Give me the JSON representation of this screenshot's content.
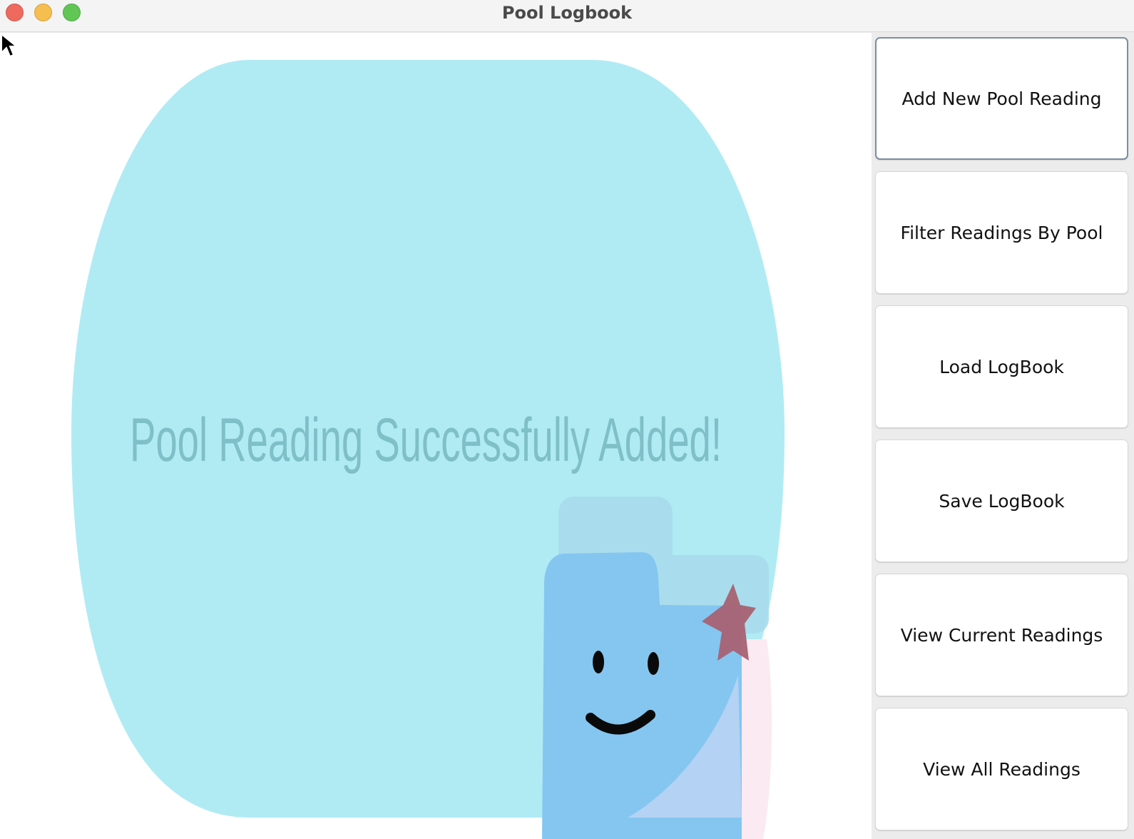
{
  "window": {
    "title": "Pool Logbook"
  },
  "canvas": {
    "message": "Pool Reading Successfully Added!",
    "illustration": "smiling-folder-with-star",
    "colors": {
      "pool": "#b0ebf4",
      "message_text": "#7fbfc8",
      "folder_front": "#84c6f0",
      "folder_back": "#a8dcec",
      "star": "#a76272"
    }
  },
  "sidebar": {
    "buttons": [
      {
        "label": "Add New Pool Reading"
      },
      {
        "label": "Filter Readings By Pool"
      },
      {
        "label": "Load LogBook"
      },
      {
        "label": "Save LogBook"
      },
      {
        "label": "View Current Readings"
      },
      {
        "label": "View All Readings"
      }
    ]
  }
}
